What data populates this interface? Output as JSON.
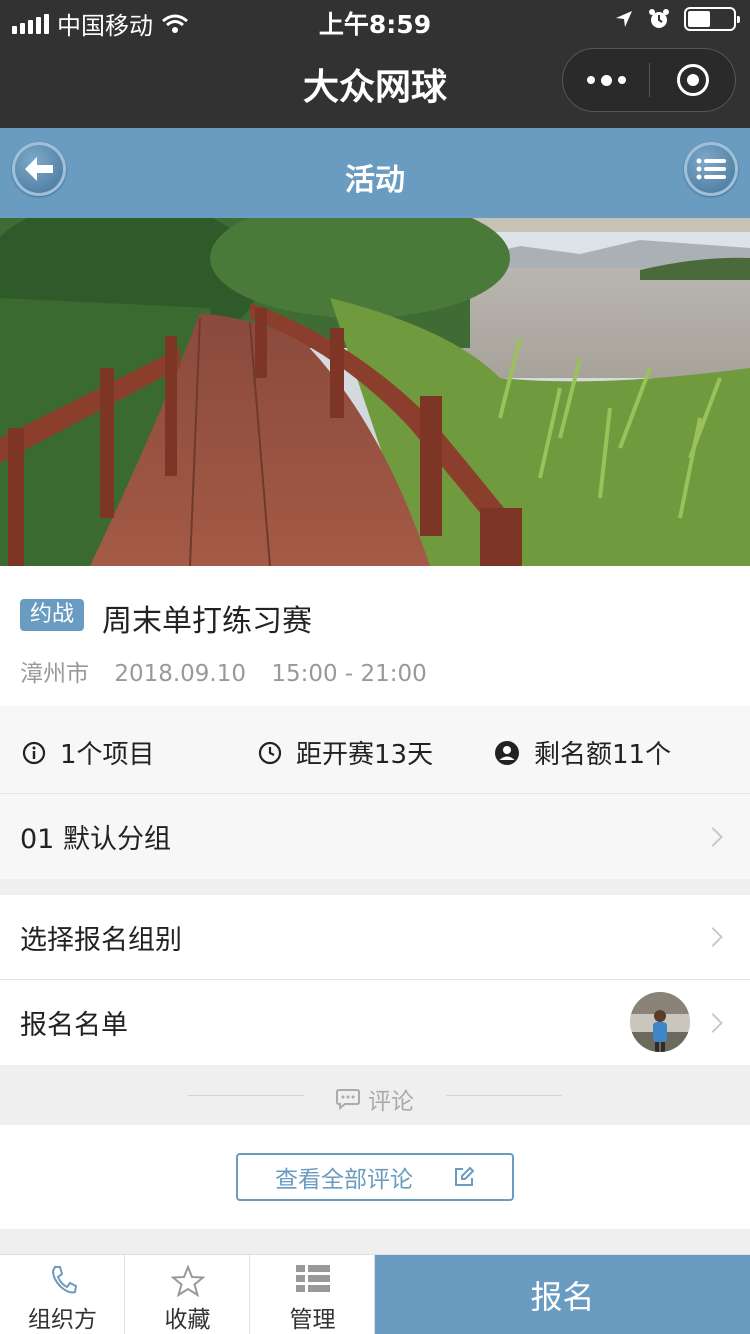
{
  "status_bar": {
    "carrier": "中国移动",
    "time": "上午8:59"
  },
  "nav": {
    "app_title": "大众网球"
  },
  "header": {
    "title": "活动"
  },
  "event": {
    "tag": "约战",
    "title": "周末单打练习赛",
    "city": "漳州市",
    "date": "2018.09.10",
    "time_range": "15:00 - 21:00"
  },
  "stats": {
    "projects": "1个项目",
    "countdown": "距开赛13天",
    "remaining": "剩名额11个"
  },
  "groups": {
    "default_group": "01  默认分组"
  },
  "rows": {
    "select_group": "选择报名组别",
    "roster": "报名名单"
  },
  "comments": {
    "section_label": "评论",
    "view_all": "查看全部评论"
  },
  "tab_bar": {
    "organizer": "组织方",
    "favorite": "收藏",
    "manage": "管理",
    "signup": "报名"
  },
  "colors": {
    "accent": "#6a9bc0",
    "nav_dark": "#323232"
  }
}
